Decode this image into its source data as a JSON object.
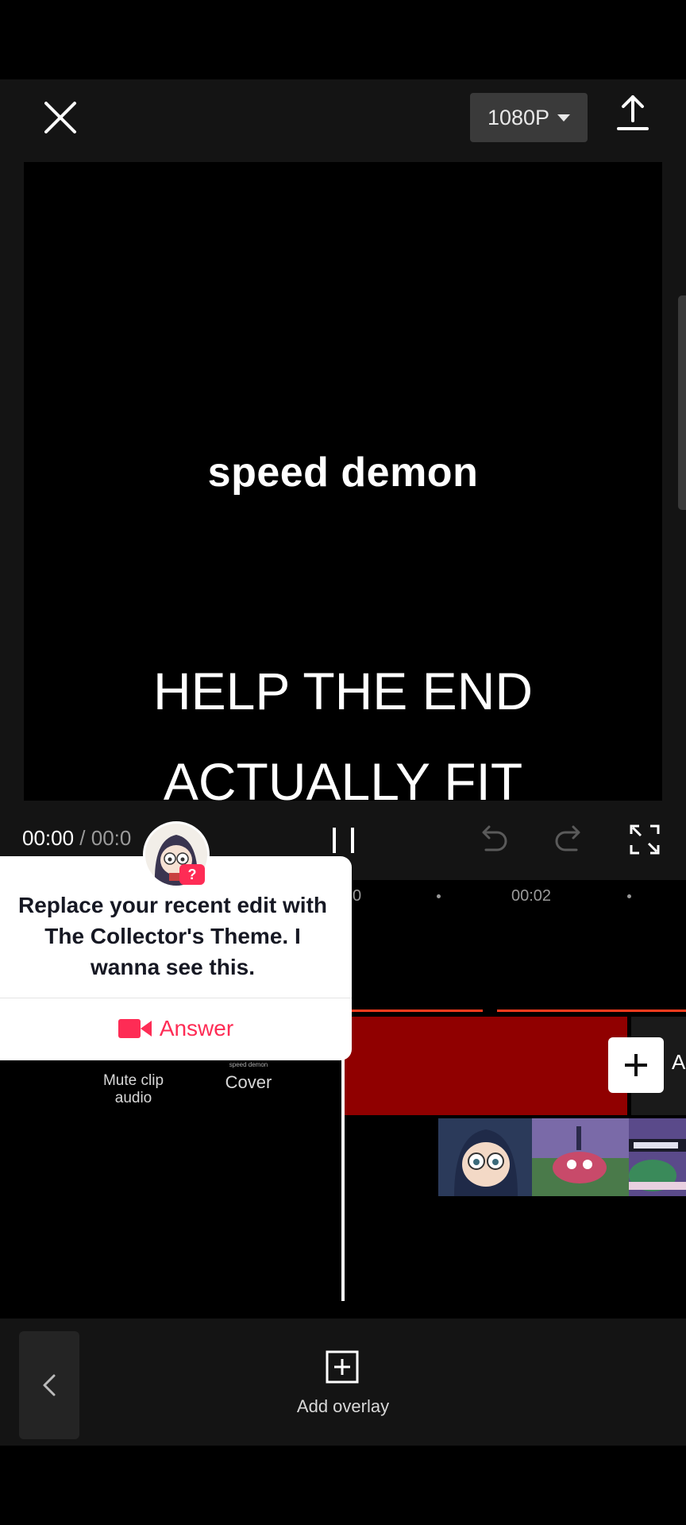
{
  "header": {
    "resolution": "1080P"
  },
  "preview": {
    "line1": "speed demon",
    "line2": "HELP THE END",
    "line3": "ACTUALLY FIT"
  },
  "player": {
    "current_time": "00:00",
    "separator": " / ",
    "duration": "00:0"
  },
  "timeline": {
    "tick_partial": "0",
    "tick_label": "00:02",
    "add_audio_partial": "A",
    "mute_label": "Mute clip audio",
    "cover_small": "speed demon",
    "cover_label": "Cover"
  },
  "popup": {
    "message": "Replace your recent edit with The Collector's Theme. I wanna see this.",
    "answer_label": "Answer",
    "badge": "?"
  },
  "bottom": {
    "add_overlay_label": "Add overlay"
  },
  "colors": {
    "accent_red": "#fe2c55",
    "clip_red": "#900000",
    "line_red": "#ff3c1e"
  }
}
